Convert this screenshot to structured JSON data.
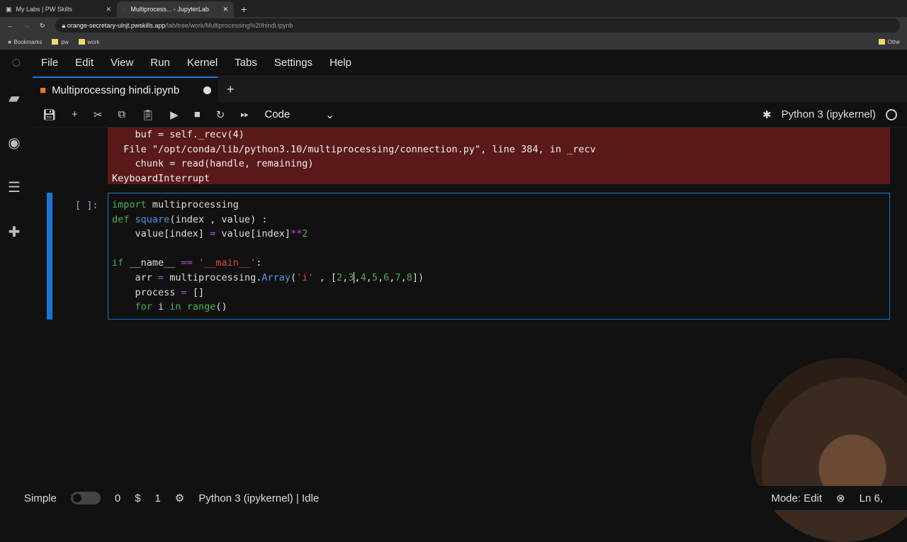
{
  "browser": {
    "tabs": [
      {
        "label": "My Labs | PW Skills"
      },
      {
        "label": "Multiprocess... - JupyterLab"
      }
    ],
    "url_host": "orange-secretary-ulnjt.pwskills.app",
    "url_path": "/lab/tree/work/Multiprocessing%20hindi.ipynb",
    "bookmarks": [
      "Bookmarks",
      "pw",
      "work"
    ],
    "other": "Othe"
  },
  "menu": [
    "File",
    "Edit",
    "View",
    "Run",
    "Kernel",
    "Tabs",
    "Settings",
    "Help"
  ],
  "doc_tab": "Multiprocessing hindi.ipynb",
  "toolbar": {
    "cell_type": "Code",
    "kernel": "Python 3 (ipykernel)"
  },
  "error_lines": [
    "    buf = self._recv(4)",
    "  File \"/opt/conda/lib/python3.10/multiprocessing/connection.py\", line 384, in _recv",
    "    chunk = read(handle, remaining)",
    "KeyboardInterrupt"
  ],
  "prompt": "[ ]:",
  "code": [
    [
      [
        "import",
        "kw"
      ],
      [
        " multiprocessing",
        ""
      ]
    ],
    [
      [
        "def",
        "kw"
      ],
      [
        " ",
        ""
      ],
      [
        "square",
        "fn"
      ],
      [
        "(index , value) :",
        ""
      ]
    ],
    [
      [
        "    value[index] ",
        ""
      ],
      [
        "=",
        "op"
      ],
      [
        " value[index]",
        ""
      ],
      [
        "**",
        "op"
      ],
      [
        "2",
        "num"
      ]
    ],
    [],
    [
      [
        "if",
        "kw"
      ],
      [
        " __name__ ",
        ""
      ],
      [
        "==",
        "op"
      ],
      [
        " ",
        ""
      ],
      [
        "'__main__'",
        "str"
      ],
      [
        ":",
        ""
      ]
    ],
    [
      [
        "    arr ",
        ""
      ],
      [
        "=",
        "op"
      ],
      [
        " multiprocessing.",
        ""
      ],
      [
        "Array",
        "fn"
      ],
      [
        "(",
        ""
      ],
      [
        "'i'",
        "str"
      ],
      [
        " , [",
        ""
      ],
      [
        "2",
        "num"
      ],
      [
        ",",
        ""
      ],
      [
        "3",
        "num"
      ],
      [
        "|",
        "cursor"
      ],
      [
        ",",
        ""
      ],
      [
        "4",
        "num"
      ],
      [
        ",",
        ""
      ],
      [
        "5",
        "num"
      ],
      [
        ",",
        ""
      ],
      [
        "6",
        "num"
      ],
      [
        ",",
        ""
      ],
      [
        "7",
        "num"
      ],
      [
        ",",
        ""
      ],
      [
        "8",
        "num"
      ],
      [
        "])",
        ""
      ]
    ],
    [
      [
        "    process ",
        ""
      ],
      [
        "=",
        "op"
      ],
      [
        " []",
        ""
      ]
    ],
    [
      [
        "    ",
        ""
      ],
      [
        "for",
        "kw"
      ],
      [
        " i ",
        ""
      ],
      [
        "in",
        "kw"
      ],
      [
        " ",
        ""
      ],
      [
        "range",
        "kw"
      ],
      [
        "()",
        ""
      ]
    ]
  ],
  "status": {
    "mode_label": "Simple",
    "count1": "0",
    "count2": "1",
    "kernel": "Python 3 (ipykernel) | Idle",
    "mode": "Mode: Edit",
    "ln": "Ln 6,"
  }
}
